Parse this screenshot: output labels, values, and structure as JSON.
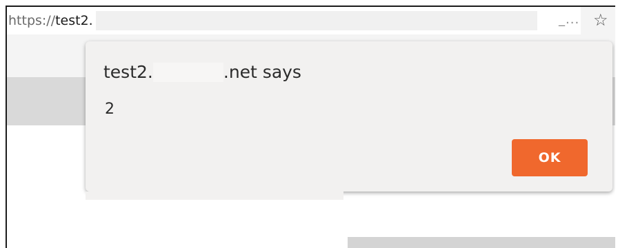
{
  "browser": {
    "url_scheme": "https://",
    "url_host": "test2.",
    "url_ellipsis": "_...",
    "bookmark_icon": "star-icon"
  },
  "alert": {
    "title_prefix": "test2.",
    "title_suffix": ".net says",
    "message": "2",
    "ok_label": "OK"
  },
  "colors": {
    "ok_button": "#f0682d",
    "dialog_bg": "#f2f1f0"
  }
}
